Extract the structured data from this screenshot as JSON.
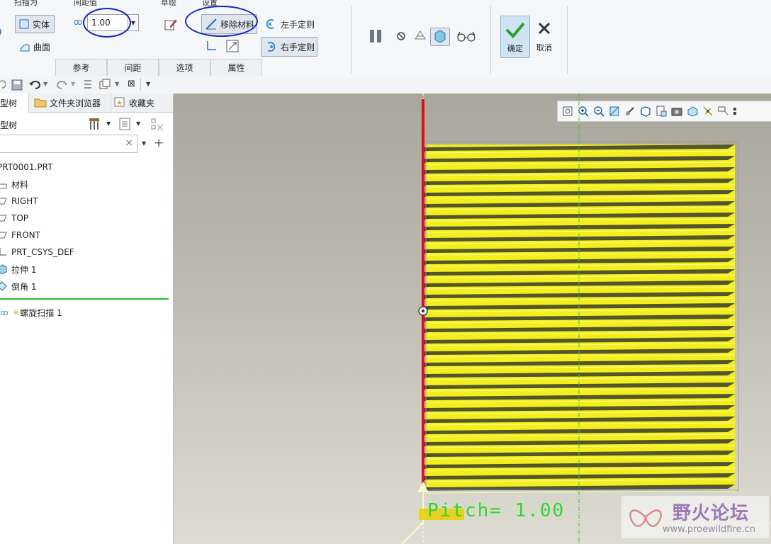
{
  "ribbon": {
    "group1_title": "扫描为",
    "solid_label": "实体",
    "surface_label": "曲面",
    "pitch_title": "间距值",
    "pitch_value": "1.00",
    "sketch_title": "草绘",
    "material_title": "设置",
    "remove_material_label": "移除材料",
    "left_hand_label": "左手定则",
    "right_hand_label": "右手定则",
    "ok_label": "确定",
    "cancel_label": "取消",
    "tabs": [
      "参考",
      "间距",
      "选项",
      "属性"
    ]
  },
  "panel": {
    "tabs": [
      "模型树",
      "文件夹浏览器",
      "收藏夹"
    ],
    "tree_title": "模型树",
    "tree_items": [
      {
        "label": "PRT0001.PRT",
        "icon": "part-icon"
      },
      {
        "label": "材料",
        "icon": "material-icon"
      },
      {
        "label": "RIGHT",
        "icon": "datum-plane-icon"
      },
      {
        "label": "TOP",
        "icon": "datum-plane-icon"
      },
      {
        "label": "FRONT",
        "icon": "datum-plane-icon"
      },
      {
        "label": "PRT_CSYS_DEF",
        "icon": "csys-icon"
      },
      {
        "label": "拉伸 1",
        "icon": "extrude-icon"
      },
      {
        "label": "倒角 1",
        "icon": "chamfer-icon"
      },
      {
        "label": "螺旋扫描 1",
        "icon": "helical-sweep-icon"
      }
    ]
  },
  "viewport": {
    "pitch_annotation": "Pitch= 1.00"
  },
  "watermark": {
    "title": "野火论坛",
    "url": "www.proewildfire.cn"
  },
  "colors": {
    "thread_yellow": "#f2ef1c",
    "axis_red": "#e01010",
    "axis_green": "#3fbf3f",
    "annotation_green": "#31d631",
    "highlight_blue": "#1826b8",
    "ok_green": "#2e9b2e"
  }
}
